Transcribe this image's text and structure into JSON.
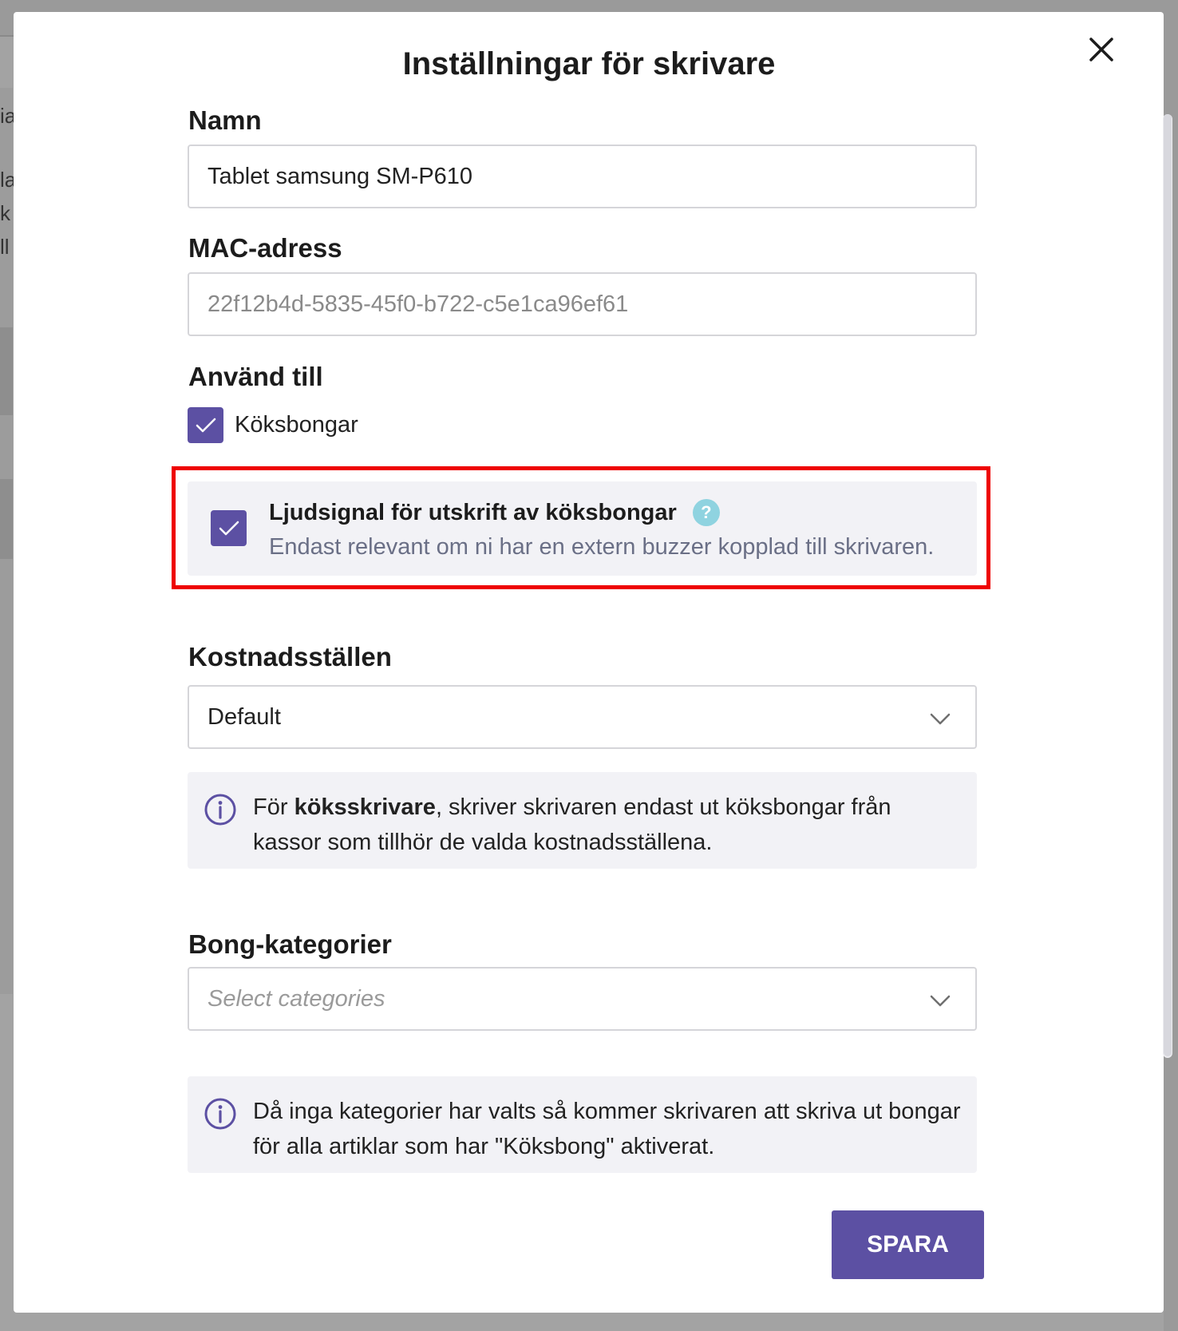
{
  "background": {
    "fragments": [
      "ia",
      "la",
      "k",
      "ll"
    ]
  },
  "modal": {
    "title": "Inställningar för skrivare",
    "close_icon": "close-icon"
  },
  "name": {
    "label": "Namn",
    "value": "Tablet samsung SM-P610"
  },
  "mac": {
    "label": "MAC-adress",
    "value": "22f12b4d-5835-45f0-b722-c5e1ca96ef61"
  },
  "use_for": {
    "label": "Använd till",
    "kitchen_receipts": {
      "label": "Köksbongar",
      "checked": true
    }
  },
  "sound_signal": {
    "checked": true,
    "title": "Ljudsignal för utskrift av köksbongar",
    "help_icon": "?",
    "description": "Endast relevant om ni har en extern buzzer kopplad till skrivaren."
  },
  "cost_centers": {
    "label": "Kostnadsställen",
    "selected": "Default",
    "info_prefix": "För ",
    "info_bold": "köksskrivare",
    "info_suffix": ", skriver skrivaren endast ut köksbongar från kassor som tillhör de valda kostnadsställena."
  },
  "categories": {
    "label": "Bong-kategorier",
    "placeholder": "Select categories",
    "info": "Då inga kategorier har valts så kommer skrivaren att skriva ut bongar för alla artiklar som har \"Köksbong\" aktiverat."
  },
  "actions": {
    "save_label": "SPARA"
  },
  "colors": {
    "accent": "#5c50a3",
    "highlight": "#ee0000",
    "help": "#8fd3e0"
  }
}
